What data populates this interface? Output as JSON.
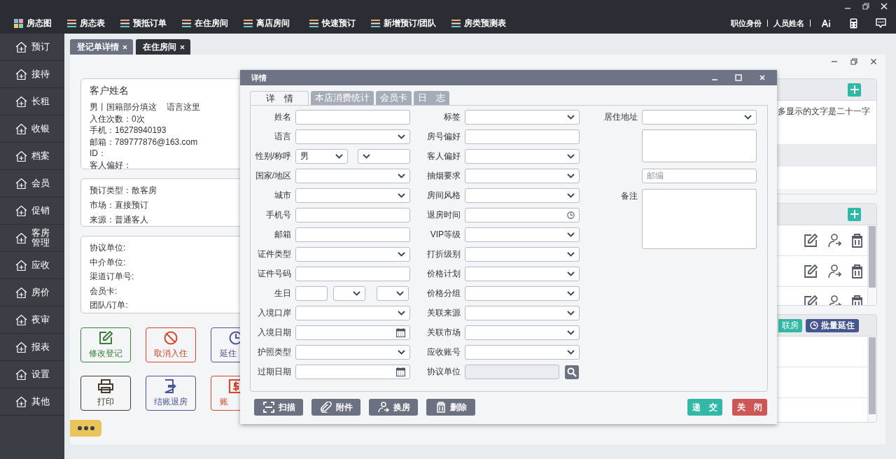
{
  "top_nav": [
    {
      "label": "房态图",
      "kind": "grid"
    },
    {
      "label": "房态表",
      "kind": "list"
    },
    {
      "label": "预抵订单",
      "kind": "list"
    },
    {
      "label": "在住房间",
      "kind": "list"
    },
    {
      "label": "离店房间",
      "kind": "list"
    },
    {
      "label": "快速预订",
      "kind": "list"
    },
    {
      "label": "新增预订/团队",
      "kind": "list"
    },
    {
      "label": "房类预测表",
      "kind": "list"
    }
  ],
  "user": {
    "position": "职位身份",
    "name": "人员姓名"
  },
  "sidebar": [
    {
      "label": "预订"
    },
    {
      "label": "接待"
    },
    {
      "label": "长租"
    },
    {
      "label": "收银"
    },
    {
      "label": "档案"
    },
    {
      "label": "会员"
    },
    {
      "label": "促销"
    },
    {
      "label": "客房管理"
    },
    {
      "label": "应收"
    },
    {
      "label": "房价"
    },
    {
      "label": "夜审"
    },
    {
      "label": "报表"
    },
    {
      "label": "设置"
    },
    {
      "label": "其他"
    }
  ],
  "tabs": [
    {
      "label": "登记单详情",
      "selected": false
    },
    {
      "label": "在住房间",
      "selected": true
    }
  ],
  "guest": {
    "name": "客户姓名",
    "nationality": "男丨国籍部分填这",
    "language": "语言这里",
    "lines": [
      "入住次数：0次",
      "手机：16278940193",
      "邮箱：789777876@163.com",
      "ID：",
      "客人偏好："
    ]
  },
  "booking": [
    "预订类型：散客房",
    "市场：直接预订",
    "来源：普通客人"
  ],
  "agency": [
    "协议单位:",
    "中介单位:",
    "渠道订单号:",
    "会员卡:",
    "团队/订单:"
  ],
  "actions": [
    {
      "label": "修改登记",
      "kind": "edit",
      "color": "#3d7f3a"
    },
    {
      "label": "取消入住",
      "kind": "cancel",
      "color": "#d8452c"
    },
    {
      "label": "延住",
      "kind": "clock",
      "color": "#4b5597"
    },
    {
      "label": "打印",
      "kind": "print",
      "color": "#4a3a2c"
    },
    {
      "label": "结账退房",
      "kind": "checkout",
      "color": "#4b5597"
    },
    {
      "label": "账",
      "kind": "bill",
      "color": "#d8452c"
    }
  ],
  "notes_panel": {
    "text": "多显示的文字是二十一字"
  },
  "link_panel": {
    "link_button": "联房",
    "extend_button": "批量延住"
  },
  "dialog": {
    "title": "详情",
    "tabs": [
      {
        "label": "详　情",
        "selected": true
      },
      {
        "label": "本店消费统计",
        "selected": false
      },
      {
        "label": "会员卡",
        "selected": false
      },
      {
        "label": "日　志",
        "selected": false
      }
    ],
    "columns": [
      [
        {
          "label": "姓名",
          "kind": "text"
        },
        {
          "label": "语言",
          "kind": "select"
        },
        {
          "label": "性别/称呼",
          "kind": "pair",
          "value": "男"
        },
        {
          "label": "国家/地区",
          "kind": "select"
        },
        {
          "label": "城市",
          "kind": "select"
        },
        {
          "label": "手机号",
          "kind": "text"
        },
        {
          "label": "邮箱",
          "kind": "text"
        },
        {
          "label": "证件类型",
          "kind": "select"
        },
        {
          "label": "证件号码",
          "kind": "text"
        },
        {
          "label": "生日",
          "kind": "birthday"
        },
        {
          "label": "入境口岸",
          "kind": "select"
        },
        {
          "label": "入境日期",
          "kind": "date"
        },
        {
          "label": "护照类型",
          "kind": "select"
        },
        {
          "label": "过期日期",
          "kind": "date"
        }
      ],
      [
        {
          "label": "标签",
          "kind": "select"
        },
        {
          "label": "房号偏好",
          "kind": "text"
        },
        {
          "label": "客人偏好",
          "kind": "select"
        },
        {
          "label": "抽烟要求",
          "kind": "select"
        },
        {
          "label": "房间风格",
          "kind": "select"
        },
        {
          "label": "退房时间",
          "kind": "time"
        },
        {
          "label": "VIP等级",
          "kind": "select"
        },
        {
          "label": "打折级别",
          "kind": "select"
        },
        {
          "label": "价格计划",
          "kind": "select"
        },
        {
          "label": "价格分组",
          "kind": "select"
        },
        {
          "label": "关联来源",
          "kind": "select"
        },
        {
          "label": "关联市场",
          "kind": "select"
        },
        {
          "label": "应收账号",
          "kind": "select"
        },
        {
          "label": "协议单位",
          "kind": "search"
        }
      ],
      [
        {
          "label": "居住地址",
          "kind": "select"
        },
        {
          "kind": "textarea"
        },
        {
          "kind": "text",
          "placeholder": "邮编"
        },
        {
          "label": "备注",
          "kind": "notes"
        }
      ]
    ],
    "tools": [
      {
        "label": "扫描",
        "kind": "scan"
      },
      {
        "label": "附件",
        "kind": "attach"
      },
      {
        "label": "换房",
        "kind": "transfer"
      },
      {
        "label": "删除",
        "kind": "delete"
      }
    ],
    "submit": "递　交",
    "close": "关　闭"
  }
}
